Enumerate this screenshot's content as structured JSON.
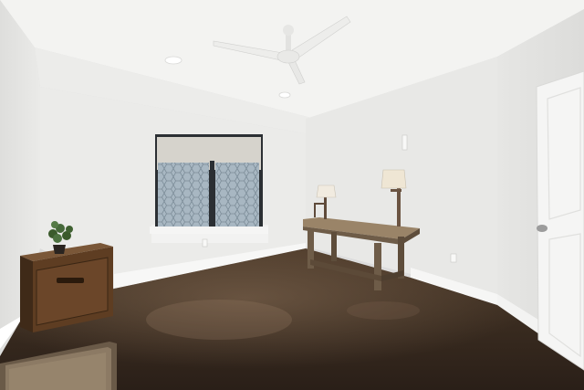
{
  "scene": {
    "room": "empty-room-interior",
    "objects": [
      "ceiling-fan",
      "recessed-light",
      "window",
      "roller-shade",
      "console-table",
      "table-lamp",
      "wooden-chest",
      "potted-plant",
      "door",
      "rug",
      "concrete-floor",
      "baseboard",
      "power-outlet",
      "light-switch"
    ]
  },
  "colors": {
    "ceiling": "#f2f2f0",
    "wall_left": "#e9e9e7",
    "wall_back": "#ececea",
    "wall_right": "#e4e4e2",
    "floor_dark": "#2f241d",
    "floor_mid": "#5a4533",
    "wood_table": "#7c6a55",
    "wood_chest": "#5a3b22",
    "door": "#f4f4f3",
    "window_frame": "#2b2f33",
    "window_glass": "#9fb0bd"
  }
}
